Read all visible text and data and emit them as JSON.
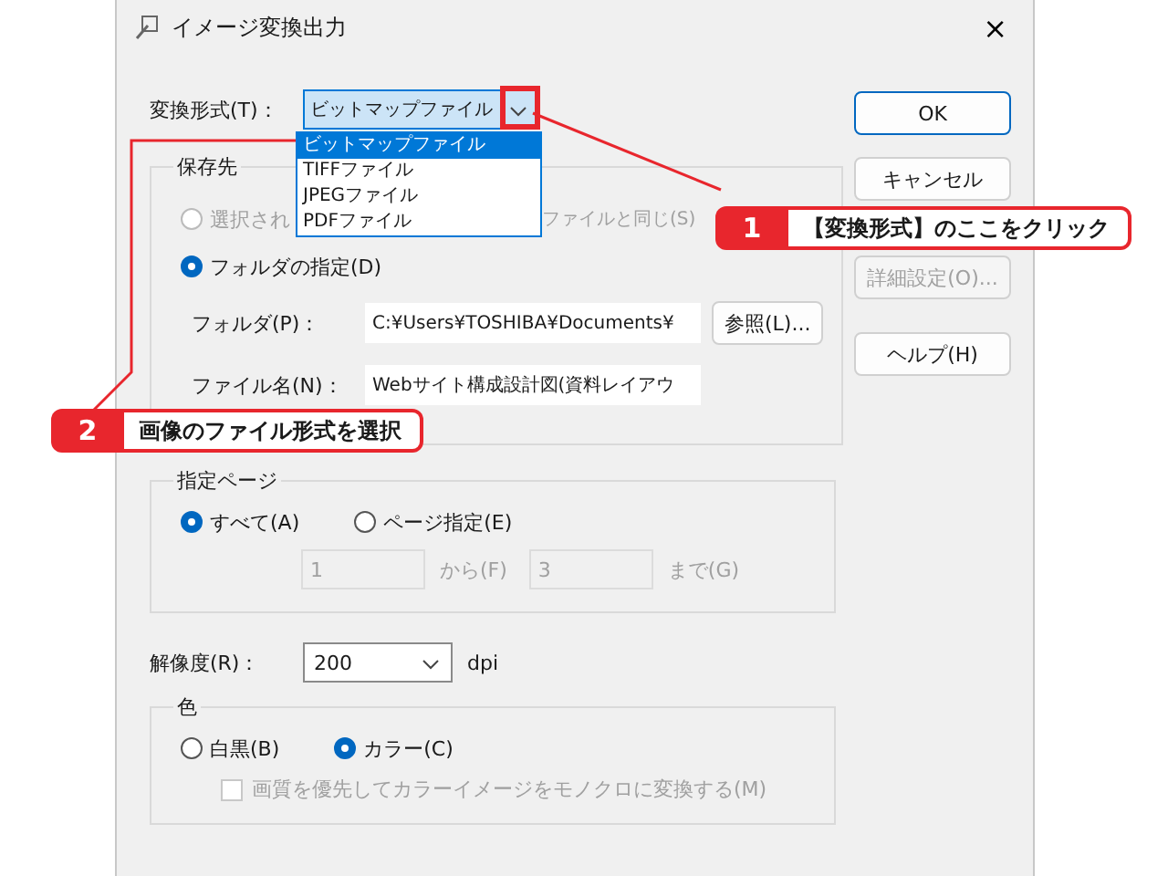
{
  "window": {
    "title": "イメージ変換出力",
    "close": "×"
  },
  "format": {
    "label": "変換形式(T)：",
    "value": "ビットマップファイル",
    "expanded": true,
    "options": [
      {
        "label": "ビットマップファイル",
        "selected": true
      },
      {
        "label": "TIFFファイル",
        "selected": false
      },
      {
        "label": "JPEGファイル",
        "selected": false
      },
      {
        "label": "PDFファイル",
        "selected": false
      }
    ]
  },
  "save_location": {
    "title": "保存先",
    "options": [
      {
        "label_start": "選択され",
        "label_end": "ファイルと同じ(S)",
        "selected": false,
        "disabled": true
      },
      {
        "label_start": "フォルダの指定(D)",
        "selected": true,
        "disabled": false
      }
    ],
    "folder": {
      "label": "フォルダ(P)：",
      "value": "C:¥Users¥TOSHIBA¥Documents¥",
      "button": "参照(L)..."
    },
    "filename": {
      "label": "ファイル名(N)：",
      "value": "Webサイト構成設計図(資料レイアウ"
    }
  },
  "pages": {
    "title": "指定ページ",
    "options": [
      {
        "label": "すべて(A)",
        "selected": true
      },
      {
        "label": "ページ指定(E)",
        "selected": false
      }
    ],
    "from": {
      "value": "1",
      "label": "から(F)",
      "disabled": true
    },
    "to": {
      "value": "3",
      "label": "まで(G)",
      "disabled": true
    }
  },
  "resolution": {
    "label": "解像度(R)：",
    "value": "200",
    "unit": "dpi"
  },
  "color": {
    "title": "色",
    "options": [
      {
        "label": "白黒(B)",
        "selected": false
      },
      {
        "label": "カラー(C)",
        "selected": true
      }
    ],
    "mono_priority": {
      "label": "画質を優先してカラーイメージをモノクロに変換する(M)",
      "checked": false,
      "disabled": true
    }
  },
  "buttons": [
    {
      "label": "OK",
      "default": true,
      "disabled": false
    },
    {
      "label": "キャンセル",
      "default": false,
      "disabled": false
    },
    {
      "label": "詳細設定(O)...",
      "default": false,
      "disabled": true
    },
    {
      "label": "ヘルプ(H)",
      "default": false,
      "disabled": false
    }
  ],
  "callouts": [
    {
      "number": "1",
      "text": "【変換形式】のここをクリック"
    },
    {
      "number": "2",
      "text": "画像のファイル形式を選択"
    }
  ]
}
